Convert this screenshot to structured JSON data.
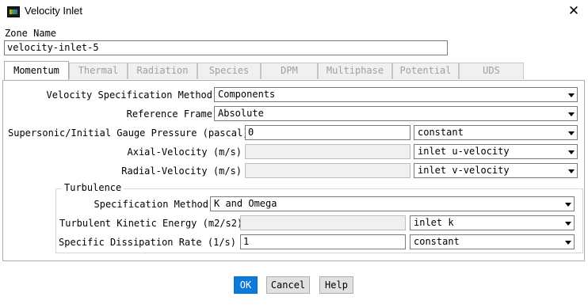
{
  "window": {
    "title": "Velocity Inlet",
    "close_glyph": "✕",
    "icon": "fluent-app-icon"
  },
  "zone": {
    "label": "Zone Name",
    "value": "velocity-inlet-5"
  },
  "tabs": [
    {
      "label": "Momentum",
      "active": true
    },
    {
      "label": "Thermal",
      "active": false
    },
    {
      "label": "Radiation",
      "active": false
    },
    {
      "label": "Species",
      "active": false
    },
    {
      "label": "DPM",
      "active": false
    },
    {
      "label": "Multiphase",
      "active": false
    },
    {
      "label": "Potential",
      "active": false
    },
    {
      "label": "UDS",
      "active": false
    }
  ],
  "momentum": {
    "velocity_method": {
      "label": "Velocity Specification Method",
      "value": "Components"
    },
    "reference_frame": {
      "label": "Reference Frame",
      "value": "Absolute"
    },
    "gauge_pressure": {
      "label": "Supersonic/Initial Gauge Pressure (pascal)",
      "value": "0",
      "profile": "constant"
    },
    "axial_velocity": {
      "label": "Axial-Velocity (m/s)",
      "value": "",
      "profile": "inlet u-velocity"
    },
    "radial_velocity": {
      "label": "Radial-Velocity (m/s)",
      "value": "",
      "profile": "inlet v-velocity"
    }
  },
  "turbulence": {
    "title": "Turbulence",
    "spec_method": {
      "label": "Specification Method",
      "value": "K and Omega"
    },
    "tke": {
      "label": "Turbulent Kinetic Energy (m2/s2)",
      "value": "",
      "profile": "inlet k"
    },
    "sdr": {
      "label": "Specific Dissipation Rate (1/s)",
      "value": "1",
      "profile": "constant"
    }
  },
  "buttons": {
    "ok": "OK",
    "cancel": "Cancel",
    "help": "Help"
  },
  "colors": {
    "accent": "#0078d7",
    "disabled_tab_text": "#a0a0a0"
  }
}
